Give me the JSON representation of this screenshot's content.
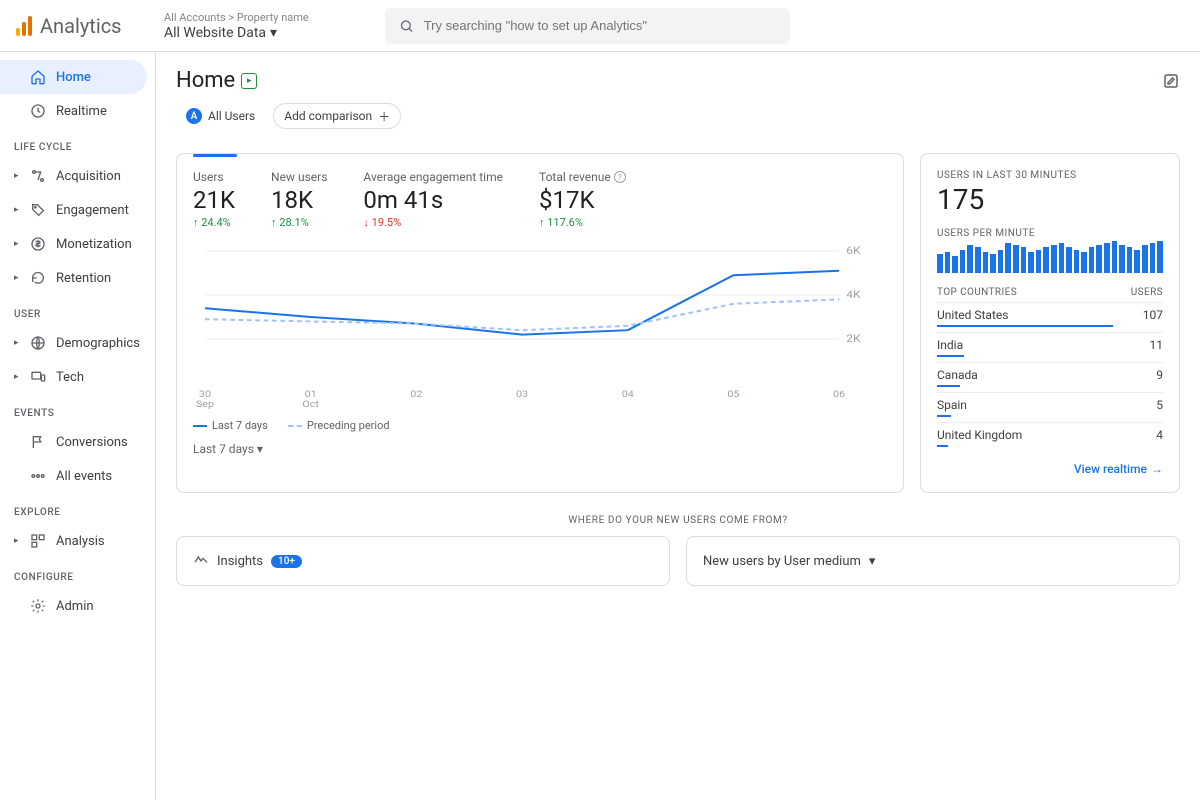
{
  "header": {
    "logo_text": "Analytics",
    "crumb_top": "All Accounts > Property name",
    "crumb_bottom": "All Website Data",
    "search_placeholder": "Try searching \"how to set up Analytics\""
  },
  "sidebar": {
    "items": [
      {
        "label": "Home",
        "active": true
      },
      {
        "label": "Realtime"
      }
    ],
    "sections": [
      {
        "title": "LIFE CYCLE",
        "items": [
          {
            "label": "Acquisition"
          },
          {
            "label": "Engagement"
          },
          {
            "label": "Monetization"
          },
          {
            "label": "Retention"
          }
        ]
      },
      {
        "title": "USER",
        "items": [
          {
            "label": "Demographics"
          },
          {
            "label": "Tech"
          }
        ]
      },
      {
        "title": "EVENTS",
        "items": [
          {
            "label": "Conversions"
          },
          {
            "label": "All events"
          }
        ]
      },
      {
        "title": "EXPLORE",
        "items": [
          {
            "label": "Analysis"
          }
        ]
      },
      {
        "title": "CONFIGURE",
        "items": [
          {
            "label": "Admin"
          }
        ]
      }
    ]
  },
  "page": {
    "title": "Home",
    "all_users_label": "All Users",
    "add_comparison_label": "Add comparison"
  },
  "stats": [
    {
      "label": "Users",
      "value": "21K",
      "delta": "24.4%",
      "dir": "up"
    },
    {
      "label": "New users",
      "value": "18K",
      "delta": "28.1%",
      "dir": "up"
    },
    {
      "label": "Average engagement time",
      "value": "0m 41s",
      "delta": "19.5%",
      "dir": "down"
    },
    {
      "label": "Total revenue",
      "value": "$17K",
      "delta": "117.6%",
      "dir": "up",
      "help": true
    }
  ],
  "chart_data": {
    "type": "line",
    "title": "",
    "xlabel": "",
    "ylabel": "",
    "ylim": [
      0,
      6000
    ],
    "y_ticks": [
      "2K",
      "4K",
      "6K"
    ],
    "categories": [
      "30\nSep",
      "01\nOct",
      "02",
      "03",
      "04",
      "05",
      "06"
    ],
    "series": [
      {
        "name": "Last 7 days",
        "style": "solid",
        "values": [
          3400,
          3000,
          2700,
          2200,
          2400,
          4900,
          5100
        ]
      },
      {
        "name": "Preceding period",
        "style": "dashed",
        "values": [
          2900,
          2800,
          2700,
          2400,
          2600,
          3600,
          3800
        ]
      }
    ],
    "range_selector": "Last 7 days"
  },
  "realtime": {
    "title": "USERS IN LAST 30 MINUTES",
    "value": "175",
    "spark_title": "USERS PER MINUTE",
    "spark": [
      18,
      20,
      16,
      22,
      26,
      24,
      20,
      18,
      22,
      28,
      26,
      24,
      20,
      22,
      24,
      26,
      28,
      24,
      22,
      20,
      24,
      26,
      28,
      30,
      26,
      24,
      22,
      26,
      28,
      30
    ],
    "countries_title": "TOP COUNTRIES",
    "users_col": "USERS",
    "countries": [
      {
        "name": "United States",
        "users": 107,
        "pct": 78
      },
      {
        "name": "India",
        "users": 11,
        "pct": 12
      },
      {
        "name": "Canada",
        "users": 9,
        "pct": 10
      },
      {
        "name": "Spain",
        "users": 5,
        "pct": 6
      },
      {
        "name": "United Kingdom",
        "users": 4,
        "pct": 5
      }
    ],
    "link": "View realtime"
  },
  "lower": {
    "question": "WHERE DO YOUR NEW USERS COME FROM?",
    "insights_label": "Insights",
    "insights_badge": "10+",
    "new_users_label": "New users by User medium"
  }
}
